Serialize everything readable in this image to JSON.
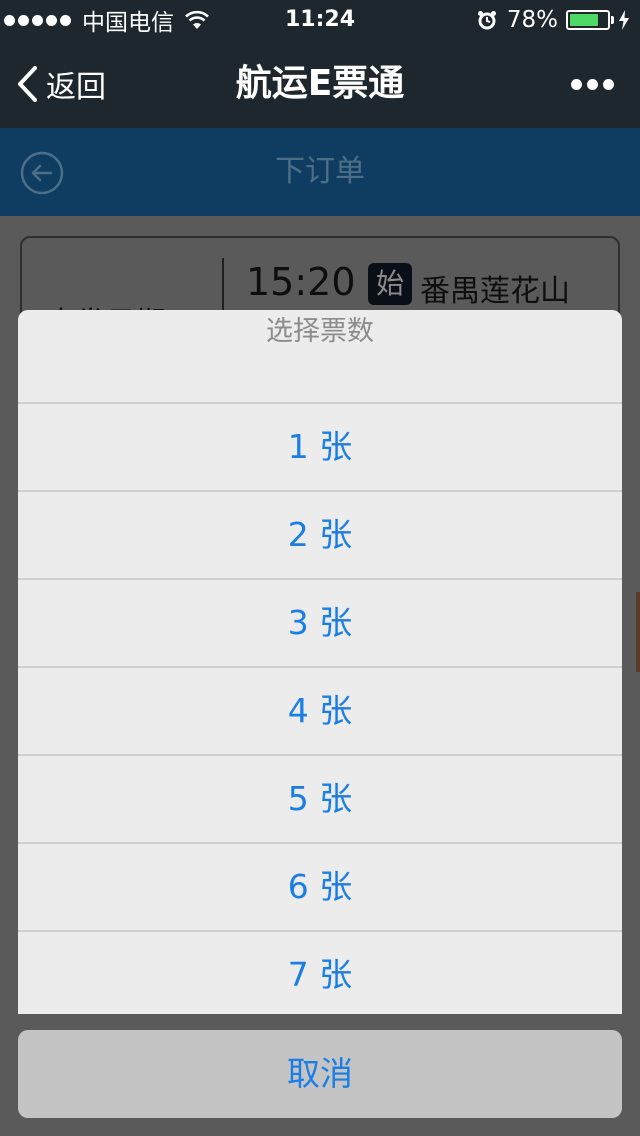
{
  "status_bar": {
    "carrier": "中国电信",
    "time": "11:24",
    "battery_percent": "78%",
    "battery_level": 0.78,
    "signal_bars": 5
  },
  "nav": {
    "back_label": "返回",
    "title": "航运E票通"
  },
  "page": {
    "title": "下订单",
    "card": {
      "date_label": "出发日期",
      "depart_time": "15:20",
      "start_badge": "始",
      "station": "番禺莲花山"
    }
  },
  "sheet": {
    "title": "选择票数",
    "options": [
      {
        "label": "1 张"
      },
      {
        "label": "2 张"
      },
      {
        "label": "3 张"
      },
      {
        "label": "4 张"
      },
      {
        "label": "5 张"
      },
      {
        "label": "6 张"
      },
      {
        "label": "7 张"
      }
    ],
    "cancel_label": "取消"
  },
  "colors": {
    "status_bg": "#1d272d",
    "page_header_bg": "#0f3d62",
    "option_text": "#1a7ee6",
    "battery_fill": "#4cd964",
    "overlay": "#5a5a5a"
  },
  "icons": {
    "wifi": "wifi-icon",
    "alarm": "alarm-icon",
    "charge": "charging-bolt-icon",
    "back": "chevron-left-icon",
    "more": "more-dots-icon",
    "page_back": "circle-arrow-left-icon"
  }
}
